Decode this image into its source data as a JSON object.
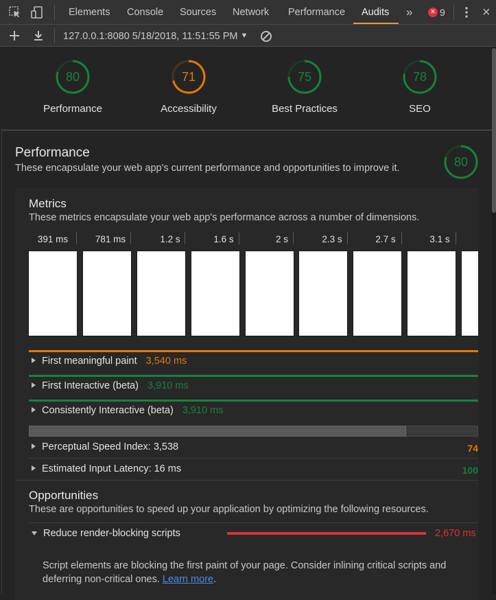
{
  "colors": {
    "pass": "#178239",
    "average": "#e67700",
    "fail": "#d8333a",
    "accent": "#f2962c"
  },
  "tabbar": {
    "icons": [
      "inspect-element-icon",
      "device-toolbar-icon"
    ],
    "tabs": [
      "Elements",
      "Console",
      "Sources",
      "Network",
      "Performance",
      "Audits"
    ],
    "active_tab": "Audits",
    "overflow": "»",
    "error_count": "9",
    "menu_icon": "kebab-menu-icon",
    "close": "×"
  },
  "toolbar": {
    "new_audit_icon": "plus-icon",
    "download_icon": "download-icon",
    "report_selector": "127.0.0.1:8080 5/18/2018, 11:51:55 PM",
    "clear_icon": "clear-icon"
  },
  "gauges": [
    {
      "label": "Performance",
      "score": "80",
      "status": "pass",
      "fraction": 0.8
    },
    {
      "label": "Accessibility",
      "score": "71",
      "status": "average",
      "fraction": 0.71
    },
    {
      "label": "Best Practices",
      "score": "75",
      "status": "pass",
      "fraction": 0.75
    },
    {
      "label": "SEO",
      "score": "78",
      "status": "pass",
      "fraction": 0.78
    }
  ],
  "performance": {
    "title": "Performance",
    "description": "These encapsulate your web app's current performance and opportunities to improve it.",
    "score": "80",
    "score_fraction": 0.8
  },
  "metrics": {
    "title": "Metrics",
    "description": "These metrics encapsulate your web app's performance across a number of dimensions.",
    "timeline_labels": [
      "391 ms",
      "781 ms",
      "1.2 s",
      "1.6 s",
      "2 s",
      "2.3 s",
      "2.7 s",
      "3.1 s"
    ],
    "items": [
      {
        "label": "First meaningful paint",
        "value": "3,540 ms",
        "status": "average"
      },
      {
        "label": "First Interactive (beta)",
        "value": "3,910 ms",
        "status": "pass"
      },
      {
        "label": "Consistently Interactive (beta)",
        "value": "3,910 ms",
        "status": "pass"
      }
    ],
    "progress_fraction": 0.84,
    "extra": [
      {
        "label": "Perceptual Speed Index: 3,538",
        "score": "74",
        "status": "average"
      },
      {
        "label": "Estimated Input Latency: 16 ms",
        "score": "100",
        "status": "pass"
      }
    ]
  },
  "opportunities": {
    "title": "Opportunities",
    "description": "These are opportunities to speed up your application by optimizing the following resources.",
    "items": [
      {
        "label": "Reduce render-blocking scripts",
        "value": "2,670 ms",
        "detail": "Script elements are blocking the first paint of your page. Consider inlining critical scripts and deferring non-critical ones.",
        "link": "Learn more",
        "after_link": "."
      }
    ]
  }
}
